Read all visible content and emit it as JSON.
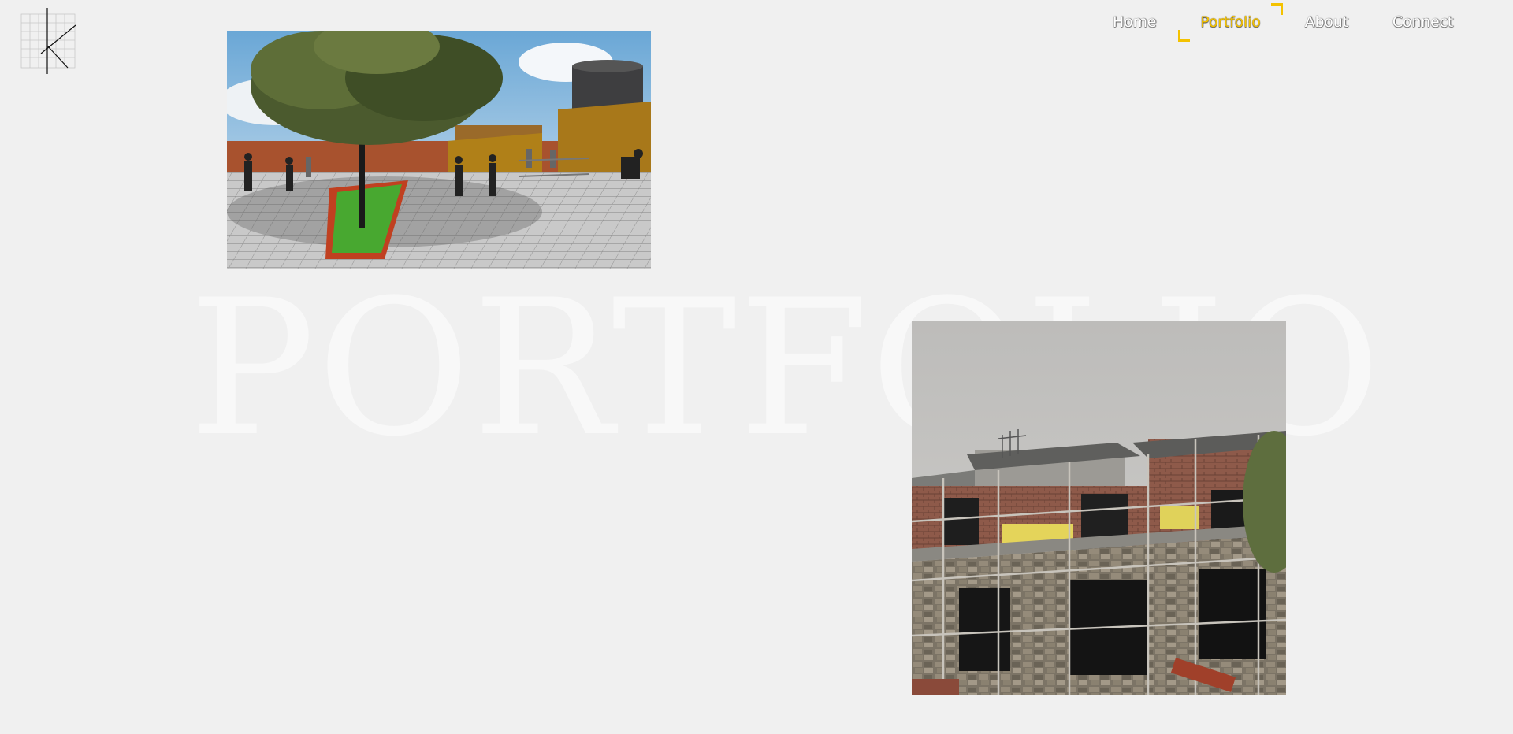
{
  "logo": {
    "icon": "grid-k-logo-icon"
  },
  "nav": {
    "items": [
      {
        "label": "Home",
        "active": false
      },
      {
        "label": "Portfolio",
        "active": true
      },
      {
        "label": "About",
        "active": false
      },
      {
        "label": "Connect",
        "active": false
      }
    ],
    "active_color": "#f4c200"
  },
  "hero": {
    "title": "PORTFOLIO"
  },
  "gallery": {
    "images": [
      {
        "name": "plaza-render-image"
      },
      {
        "name": "stone-building-construction-image"
      }
    ]
  },
  "colors": {
    "background": "#f0f0f0",
    "accent": "#f4c200"
  }
}
